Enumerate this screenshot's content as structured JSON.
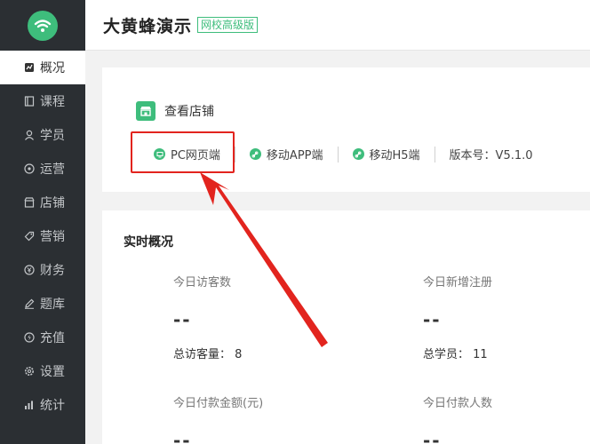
{
  "sidebar": {
    "items": [
      {
        "label": "概况",
        "icon": "overview-icon",
        "active": true
      },
      {
        "label": "课程",
        "icon": "course-icon"
      },
      {
        "label": "学员",
        "icon": "student-icon"
      },
      {
        "label": "运营",
        "icon": "operation-icon"
      },
      {
        "label": "店铺",
        "icon": "store-icon"
      },
      {
        "label": "营销",
        "icon": "tag-icon"
      },
      {
        "label": "财务",
        "icon": "finance-icon"
      },
      {
        "label": "题库",
        "icon": "pen-icon"
      },
      {
        "label": "充值",
        "icon": "recharge-icon"
      },
      {
        "label": "设置",
        "icon": "gear-icon"
      },
      {
        "label": "统计",
        "icon": "stats-icon"
      }
    ]
  },
  "header": {
    "title": "大黄蜂演示",
    "badge": "网校高级版"
  },
  "store": {
    "view_label": "查看店铺",
    "platforms": [
      "PC网页端",
      "移动APP端",
      "移动H5端"
    ],
    "version": "版本号：V5.1.0"
  },
  "realtime": {
    "title": "实时概况",
    "stats": [
      {
        "label": "今日访客数",
        "value": "--",
        "total": "总访客量： 8"
      },
      {
        "label": "今日新增注册",
        "value": "--",
        "total": "总学员： 11"
      },
      {
        "label": "今日付款金额(元)",
        "value": "--",
        "total": ""
      },
      {
        "label": "今日付款人数",
        "value": "--",
        "total": ""
      }
    ]
  },
  "colors": {
    "accent": "#3ebd7c",
    "sidebar_bg": "#2b2f33",
    "annotation": "#e2241e"
  }
}
